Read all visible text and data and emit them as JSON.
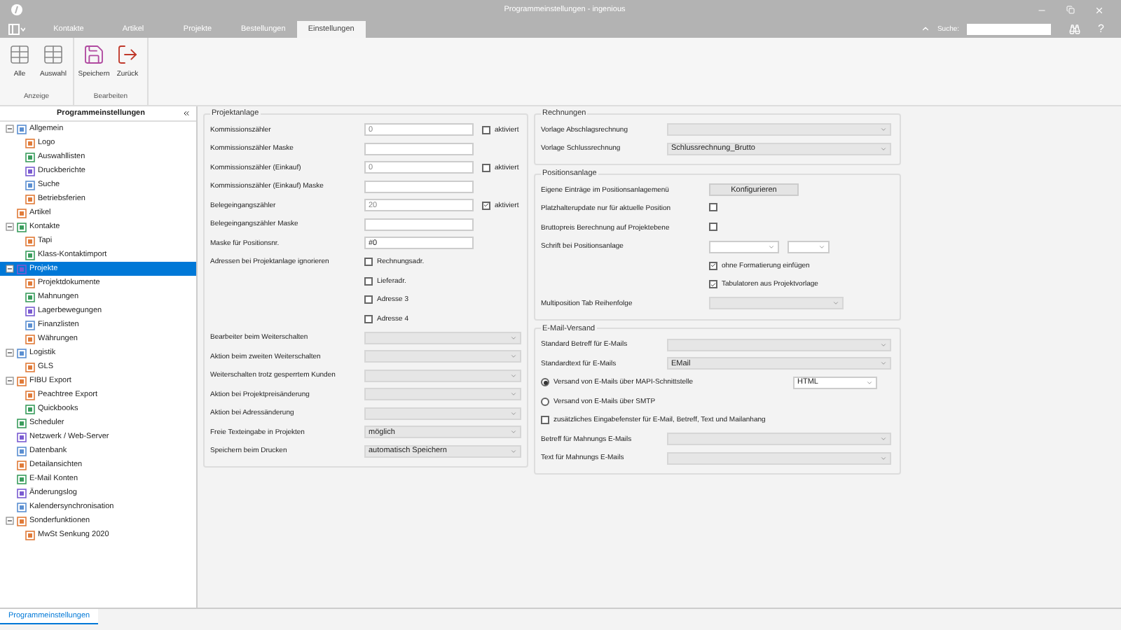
{
  "window": {
    "title": "Programmeinstellungen - ingenious"
  },
  "menu_tabs": [
    {
      "label": "Kontakte",
      "selected": false
    },
    {
      "label": "Artikel",
      "selected": false
    },
    {
      "label": "Projekte",
      "selected": false
    },
    {
      "label": "Bestellungen",
      "selected": false
    },
    {
      "label": "Einstellungen",
      "selected": true
    }
  ],
  "search": {
    "label": "Suche:"
  },
  "help": "?",
  "ribbon": [
    {
      "label": "Anzeige",
      "buttons": [
        {
          "label": "Alle",
          "kind": "grid"
        },
        {
          "label": "Auswahl",
          "kind": "grid"
        }
      ]
    },
    {
      "label": "Bearbeiten",
      "buttons": [
        {
          "label": "Speichern",
          "kind": "save"
        },
        {
          "label": "Zurück",
          "kind": "exit"
        }
      ]
    }
  ],
  "sidebar": {
    "title": "Programmeinstellungen",
    "items": [
      {
        "label": "Allgemein",
        "selected": false,
        "expanded": true,
        "children": [
          {
            "label": "Logo",
            "selected": false
          },
          {
            "label": "Auswahllisten",
            "selected": false
          },
          {
            "label": "Druckberichte",
            "selected": false
          },
          {
            "label": "Suche",
            "selected": false
          },
          {
            "label": "Betriebsferien",
            "selected": false
          }
        ]
      },
      {
        "label": "Artikel",
        "selected": false
      },
      {
        "label": "Kontakte",
        "selected": false,
        "expanded": true,
        "children": [
          {
            "label": "Tapi",
            "selected": false
          },
          {
            "label": "Klass-Kontaktimport",
            "selected": false
          }
        ]
      },
      {
        "label": "Projekte",
        "selected": true,
        "expanded": true,
        "children": [
          {
            "label": "Projektdokumente",
            "selected": false
          },
          {
            "label": "Mahnungen",
            "selected": false
          },
          {
            "label": "Lagerbewegungen",
            "selected": false
          },
          {
            "label": "Finanzlisten",
            "selected": false
          },
          {
            "label": "Währungen",
            "selected": false
          }
        ]
      },
      {
        "label": "Logistik",
        "selected": false,
        "expanded": true,
        "children": [
          {
            "label": "GLS",
            "selected": false
          }
        ]
      },
      {
        "label": "FIBU Export",
        "selected": false,
        "expanded": true,
        "children": [
          {
            "label": "Peachtree Export",
            "selected": false
          },
          {
            "label": "Quickbooks",
            "selected": false
          }
        ]
      },
      {
        "label": "Scheduler",
        "selected": false
      },
      {
        "label": "Netzwerk / Web-Server",
        "selected": false
      },
      {
        "label": "Datenbank",
        "selected": false
      },
      {
        "label": "Detailansichten",
        "selected": false
      },
      {
        "label": "E-Mail Konten",
        "selected": false
      },
      {
        "label": "Änderungslog",
        "selected": false
      },
      {
        "label": "Kalendersynchronisation",
        "selected": false
      },
      {
        "label": "Sonderfunktionen",
        "selected": false,
        "expanded": true,
        "children": [
          {
            "label": "MwSt Senkung 2020",
            "selected": false
          }
        ]
      }
    ]
  },
  "projektanlage": {
    "title": "Projektanlage",
    "rows": [
      {
        "kind": "text",
        "label": "Kommissionszähler",
        "value": "0",
        "disabled": true,
        "option": {
          "label": "aktiviert",
          "checked": false
        }
      },
      {
        "kind": "text",
        "label": "Kommissionszähler Maske"
      },
      {
        "kind": "text",
        "label": "Kommissionszähler (Einkauf)",
        "value": "0",
        "disabled": true,
        "option": {
          "label": "aktiviert",
          "checked": false
        }
      },
      {
        "kind": "text",
        "label": "Kommissionszähler (Einkauf) Maske"
      },
      {
        "kind": "text",
        "label": "Belegeingangszähler",
        "value": "20",
        "disabled": true,
        "option": {
          "label": "aktiviert",
          "checked": true
        }
      },
      {
        "kind": "text",
        "label": "Belegeingangszähler Maske"
      },
      {
        "kind": "text",
        "label": "Maske für Positionsnr.",
        "value": "#0",
        "disabled": false
      },
      {
        "kind": "checks",
        "label": "Adressen bei Projektanlage ignorieren",
        "options": [
          {
            "label": "Rechnungsadr.",
            "checked": false
          },
          {
            "label": "Lieferadr.",
            "checked": false
          },
          {
            "label": "Adresse 3",
            "checked": false
          },
          {
            "label": "Adresse 4",
            "checked": false
          }
        ]
      },
      {
        "kind": "select",
        "label": "Bearbeiter beim Weiterschalten"
      },
      {
        "kind": "select",
        "label": "Aktion beim zweiten Weiterschalten"
      },
      {
        "kind": "select",
        "label": "Weiterschalten trotz gesperrtem Kunden"
      },
      {
        "kind": "select",
        "label": "Aktion bei Projektpreisänderung"
      },
      {
        "kind": "select",
        "label": "Aktion bei Adressänderung"
      },
      {
        "kind": "select",
        "label": "Freie Texteingabe in Projekten",
        "value": "möglich"
      },
      {
        "kind": "select",
        "label": "Speichern beim Drucken",
        "value": "automatisch Speichern"
      }
    ]
  },
  "rechnungen": {
    "title": "Rechnungen",
    "rows": [
      {
        "kind": "select",
        "label": "Vorlage Abschlagsrechnung"
      },
      {
        "kind": "select",
        "label": "Vorlage Schlussrechnung",
        "value": "Schlussrechnung_Brutto"
      }
    ]
  },
  "positionsanlage": {
    "title": "Positionsanlage",
    "rows": [
      {
        "kind": "button",
        "label": "Eigene Einträge im Positionsanlagemenü",
        "button": "Konfigurieren"
      },
      {
        "kind": "check",
        "label": "Platzhalterupdate nur für aktuelle Position",
        "checked": false
      },
      {
        "kind": "check",
        "label": "Bruttopreis Berechnung auf Projektebene",
        "checked": false
      },
      {
        "kind": "fonts",
        "label": "Schrift bei Positionsanlage"
      },
      {
        "kind": "option",
        "label": "ohne Formatierung einfügen",
        "checked": true
      },
      {
        "kind": "option",
        "label": "Tabulatoren aus Projektvorlage",
        "checked": true
      },
      {
        "kind": "select",
        "label": "Multiposition Tab Reihenfolge"
      }
    ]
  },
  "email": {
    "title": "E-Mail-Versand",
    "rows": [
      {
        "kind": "select",
        "label": "Standard Betreff für E-Mails"
      },
      {
        "kind": "select",
        "label": "Standardtext für E-Mails",
        "value": "EMail"
      },
      {
        "kind": "radio",
        "label": "Versand von E-Mails über MAPI-Schnittstelle",
        "selected": true,
        "value": "HTML"
      },
      {
        "kind": "radio",
        "label": "Versand von E-Mails über SMTP",
        "selected": false
      },
      {
        "kind": "option",
        "label": "zusätzliches Eingabefenster für E-Mail, Betreff, Text und Mailanhang",
        "checked": false
      },
      {
        "kind": "select",
        "label": "Betreff für Mahnungs E-Mails"
      },
      {
        "kind": "select",
        "label": "Text für Mahnungs E-Mails"
      }
    ]
  },
  "bottom_tab": {
    "label": "Programmeinstellungen"
  }
}
